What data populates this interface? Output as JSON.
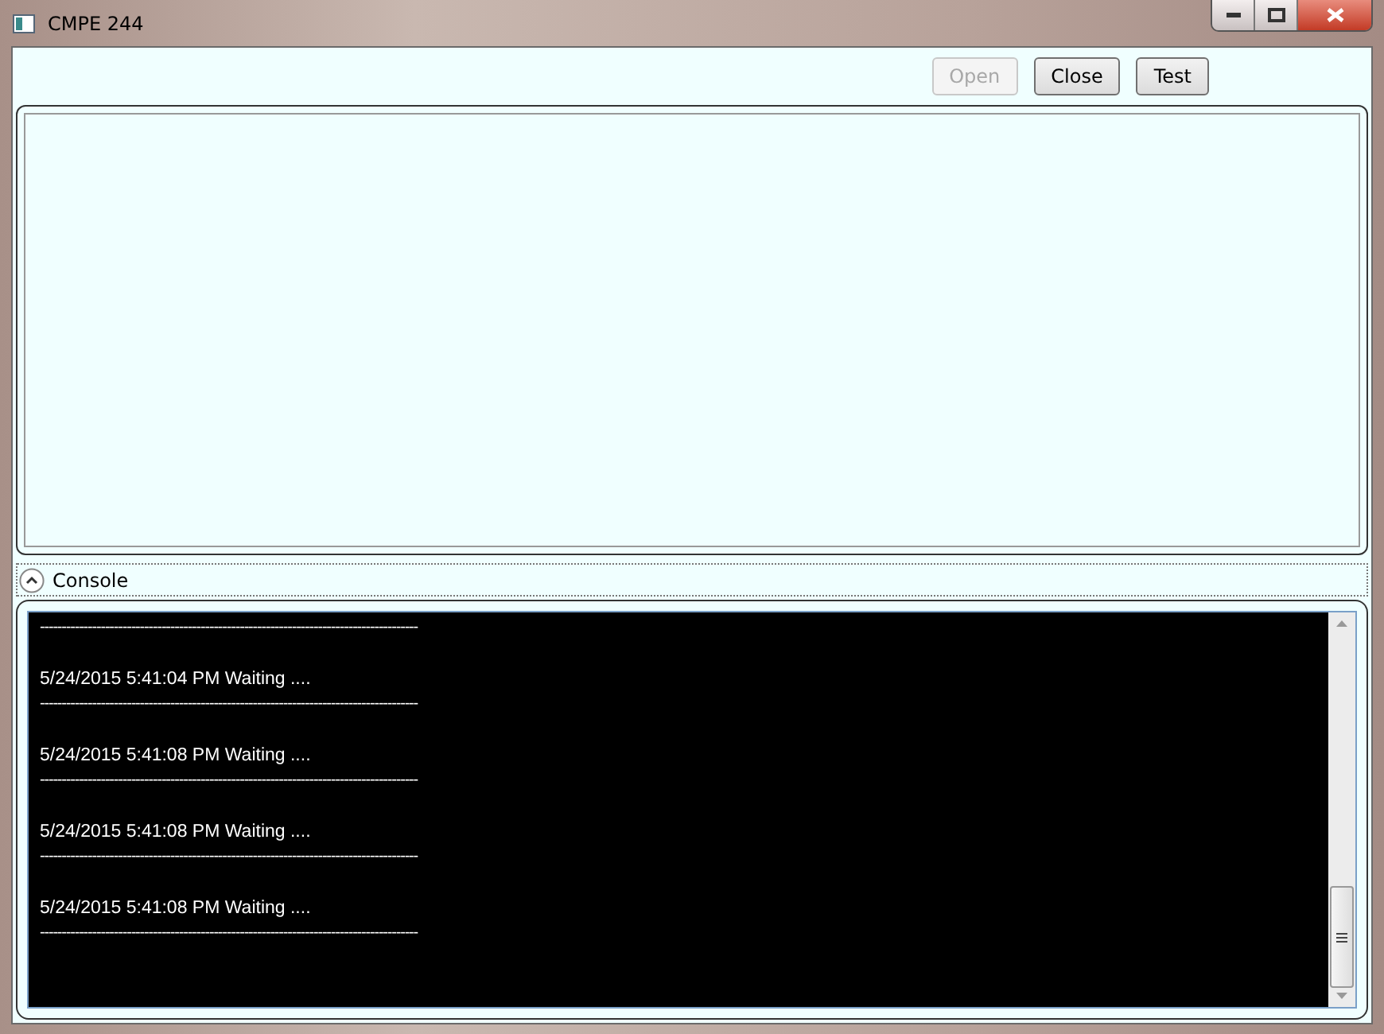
{
  "window": {
    "title": "CMPE 244"
  },
  "toolbar": {
    "buttons": [
      {
        "label": "Open",
        "disabled": true
      },
      {
        "label": "Close",
        "disabled": false
      },
      {
        "label": "Test",
        "disabled": false
      }
    ]
  },
  "console": {
    "header": "Console",
    "expanded": true,
    "entries": [
      {
        "rule": "---------------------------------------------------------------------------------------"
      },
      {
        "text": "5/24/2015 5:41:04 PM Waiting ....",
        "rule": "---------------------------------------------------------------------------------------"
      },
      {
        "text": "5/24/2015 5:41:08 PM Waiting ....",
        "rule": "---------------------------------------------------------------------------------------"
      },
      {
        "text": "5/24/2015 5:41:08 PM Waiting ....",
        "rule": "---------------------------------------------------------------------------------------"
      },
      {
        "text": "5/24/2015 5:41:08 PM Waiting ....",
        "rule": "---------------------------------------------------------------------------------------"
      }
    ]
  }
}
